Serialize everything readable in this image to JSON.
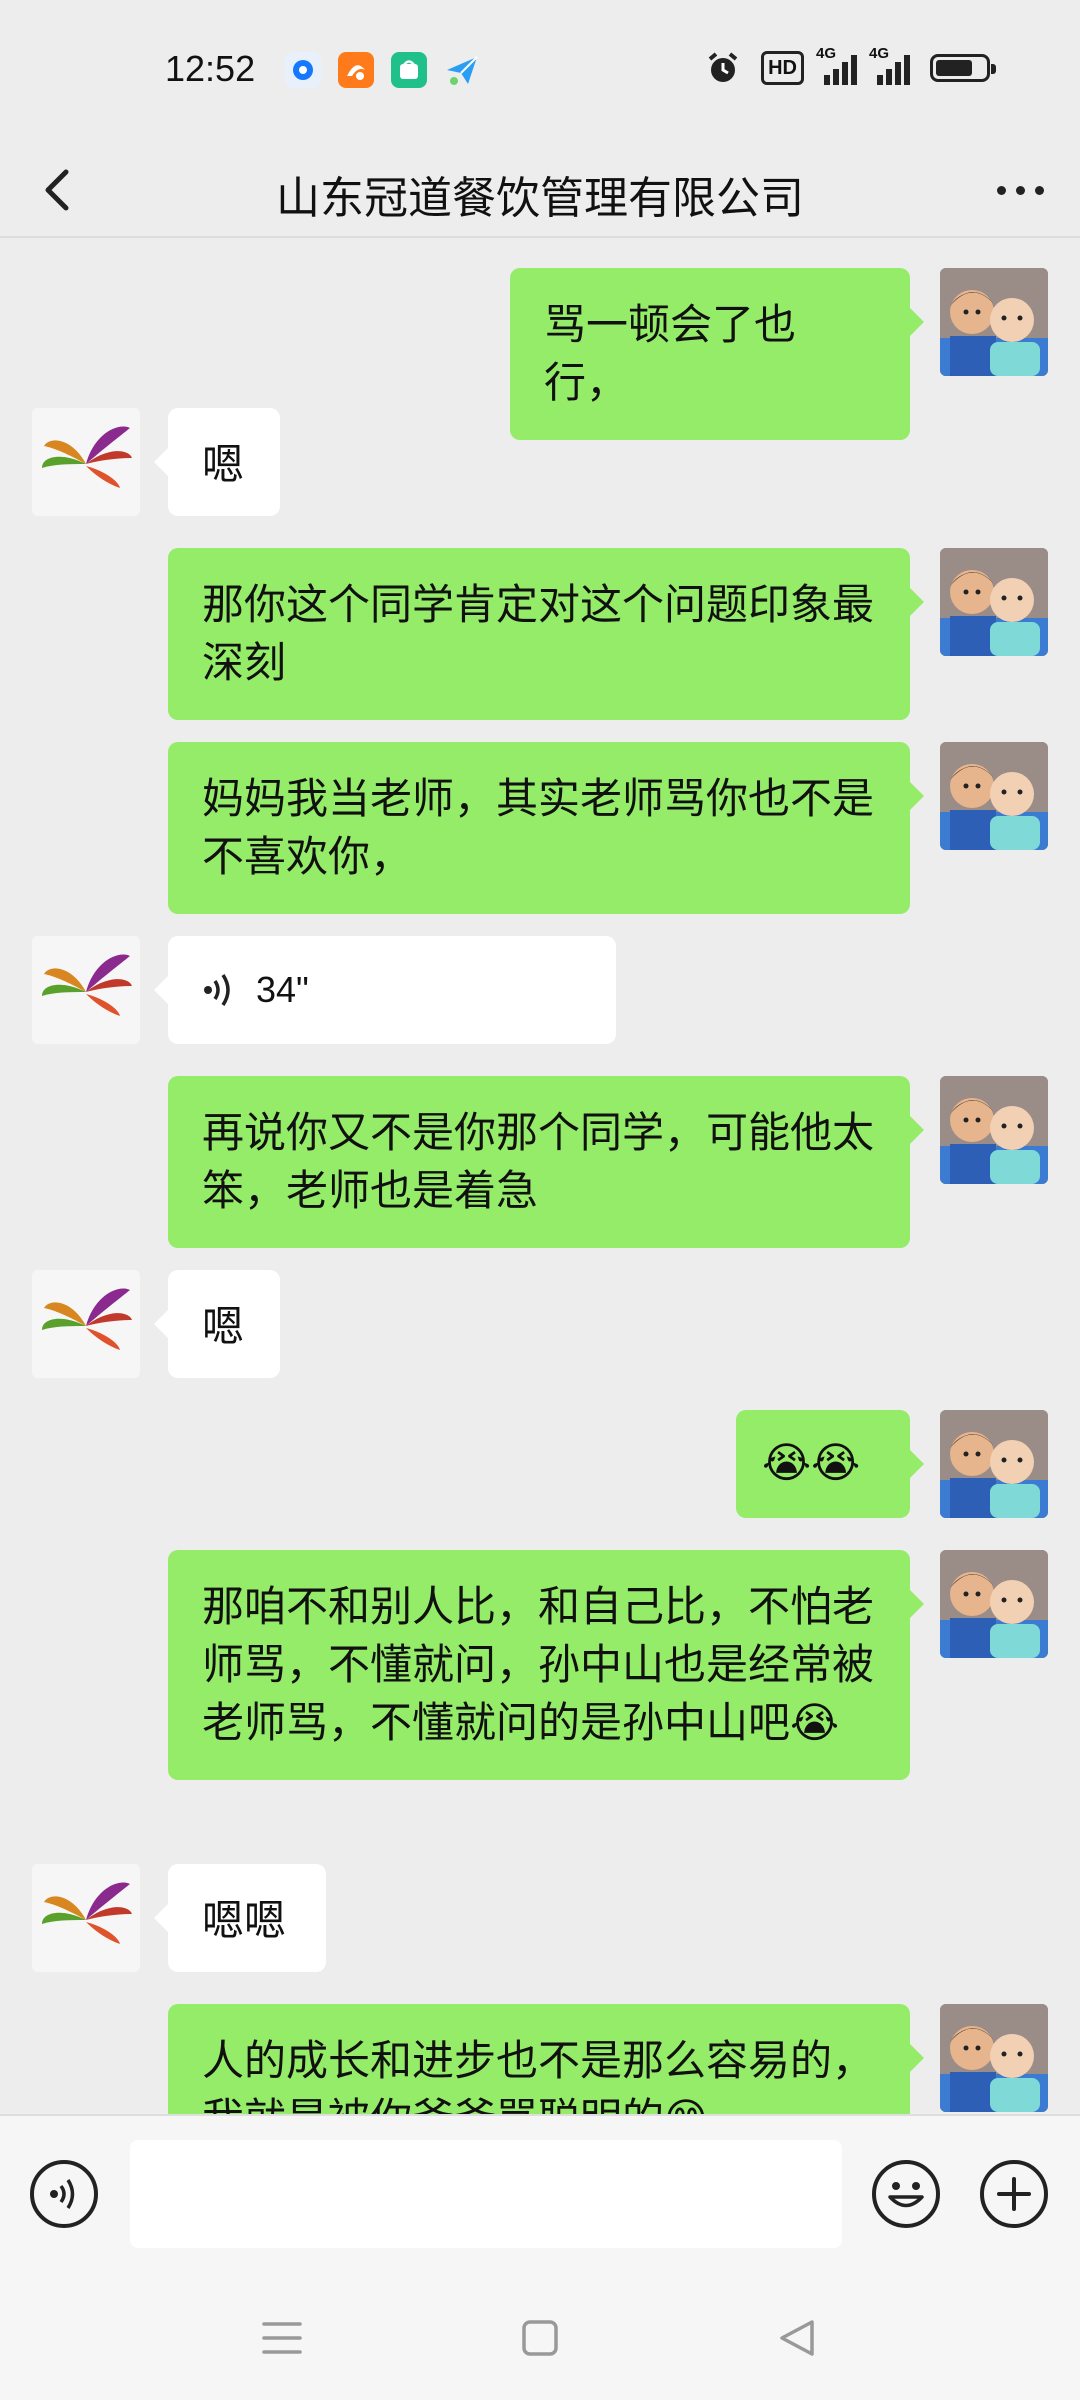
{
  "status_bar": {
    "time": "12:52",
    "hd_label": "HD",
    "network_1": "4G",
    "network_2": "4G",
    "battery_level": 0.75,
    "notification_icons": [
      "browser-icon",
      "uc-browser-icon",
      "app-store-icon",
      "paper-plane-icon"
    ],
    "system_icons": [
      "alarm-icon",
      "hd-icon",
      "signal-icon",
      "signal-icon",
      "battery-icon"
    ]
  },
  "header": {
    "title": "山东冠道餐饮管理有限公司",
    "back_icon": "back-chevron-icon",
    "more_icon": "more-dots-icon"
  },
  "messages": [
    {
      "side": "out",
      "text": "骂一顿会了也行，"
    },
    {
      "side": "in",
      "text": "嗯"
    },
    {
      "side": "out",
      "text": "那你这个同学肯定对这个问题印象最深刻"
    },
    {
      "side": "out",
      "text": "妈妈我当老师，其实老师骂你也不是不喜欢你，"
    },
    {
      "side": "in",
      "type": "voice",
      "duration": "34\""
    },
    {
      "side": "out",
      "text": "再说你又不是你那个同学，可能他太笨，老师也是着急"
    },
    {
      "side": "in",
      "text": "嗯"
    },
    {
      "side": "out",
      "text": "😭😭"
    },
    {
      "side": "out",
      "text": "那咱不和别人比，和自己比，不怕老师骂，不懂就问，孙中山也是经常被老师骂，不懂就问的是孙中山吧😭"
    },
    {
      "side": "in",
      "text": "嗯嗯"
    },
    {
      "side": "out",
      "text": "人的成长和进步也不是那么容易的，我就是被你爷爷骂聪明的😁"
    }
  ],
  "input_bar": {
    "voice_icon": "voice-input-icon",
    "input_value": "",
    "emoji_icon": "emoji-icon",
    "plus_icon": "plus-icon"
  },
  "nav_bar": {
    "icons": [
      "menu-icon",
      "home-icon",
      "back-triangle-icon"
    ]
  },
  "colors": {
    "outgoing_bubble": "#95ec69",
    "incoming_bubble": "#ffffff",
    "background": "#ededed"
  }
}
